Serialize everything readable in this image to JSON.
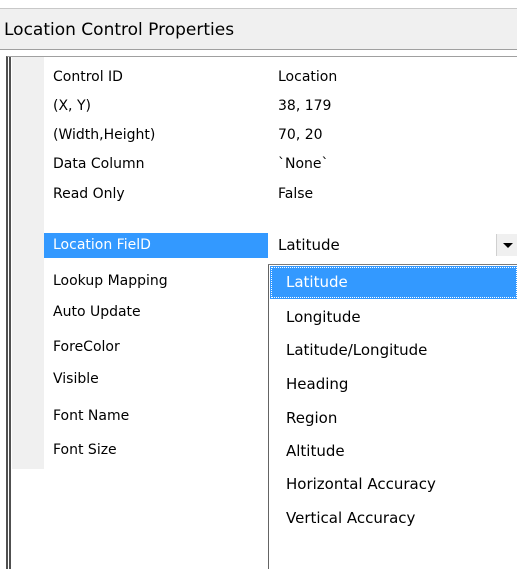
{
  "window": {
    "title": "Location Control Properties"
  },
  "properties": [
    {
      "name": "Control ID",
      "value": "Location"
    },
    {
      "name": "(X, Y)",
      "value": "38, 179"
    },
    {
      "name": "(Width,Height)",
      "value": "70, 20"
    },
    {
      "name": "Data Column",
      "value": "`None`"
    },
    {
      "name": "Read Only",
      "value": "False"
    },
    {
      "name": "Location FielD",
      "value": "Latitude",
      "selected": true
    },
    {
      "name": "Lookup Mapping",
      "value": ""
    },
    {
      "name": "Auto Update",
      "value": ""
    },
    {
      "name": "ForeColor",
      "value": ""
    },
    {
      "name": "Visible",
      "value": ""
    },
    {
      "name": "Font Name",
      "value": ""
    },
    {
      "name": "Font Size",
      "value": ""
    }
  ],
  "dropdown": {
    "selected": "Latitude",
    "options": [
      "Latitude",
      "Longitude",
      "Latitude/Longitude",
      "Heading",
      "Region",
      "Altitude",
      "Horizontal Accuracy",
      "Vertical Accuracy"
    ]
  },
  "colors": {
    "selection": "#3399ff",
    "title_bar": "#f0f0f0",
    "gutter": "#f0f0f0"
  },
  "icons": {
    "dropdown_button": "chevron-down-icon"
  }
}
